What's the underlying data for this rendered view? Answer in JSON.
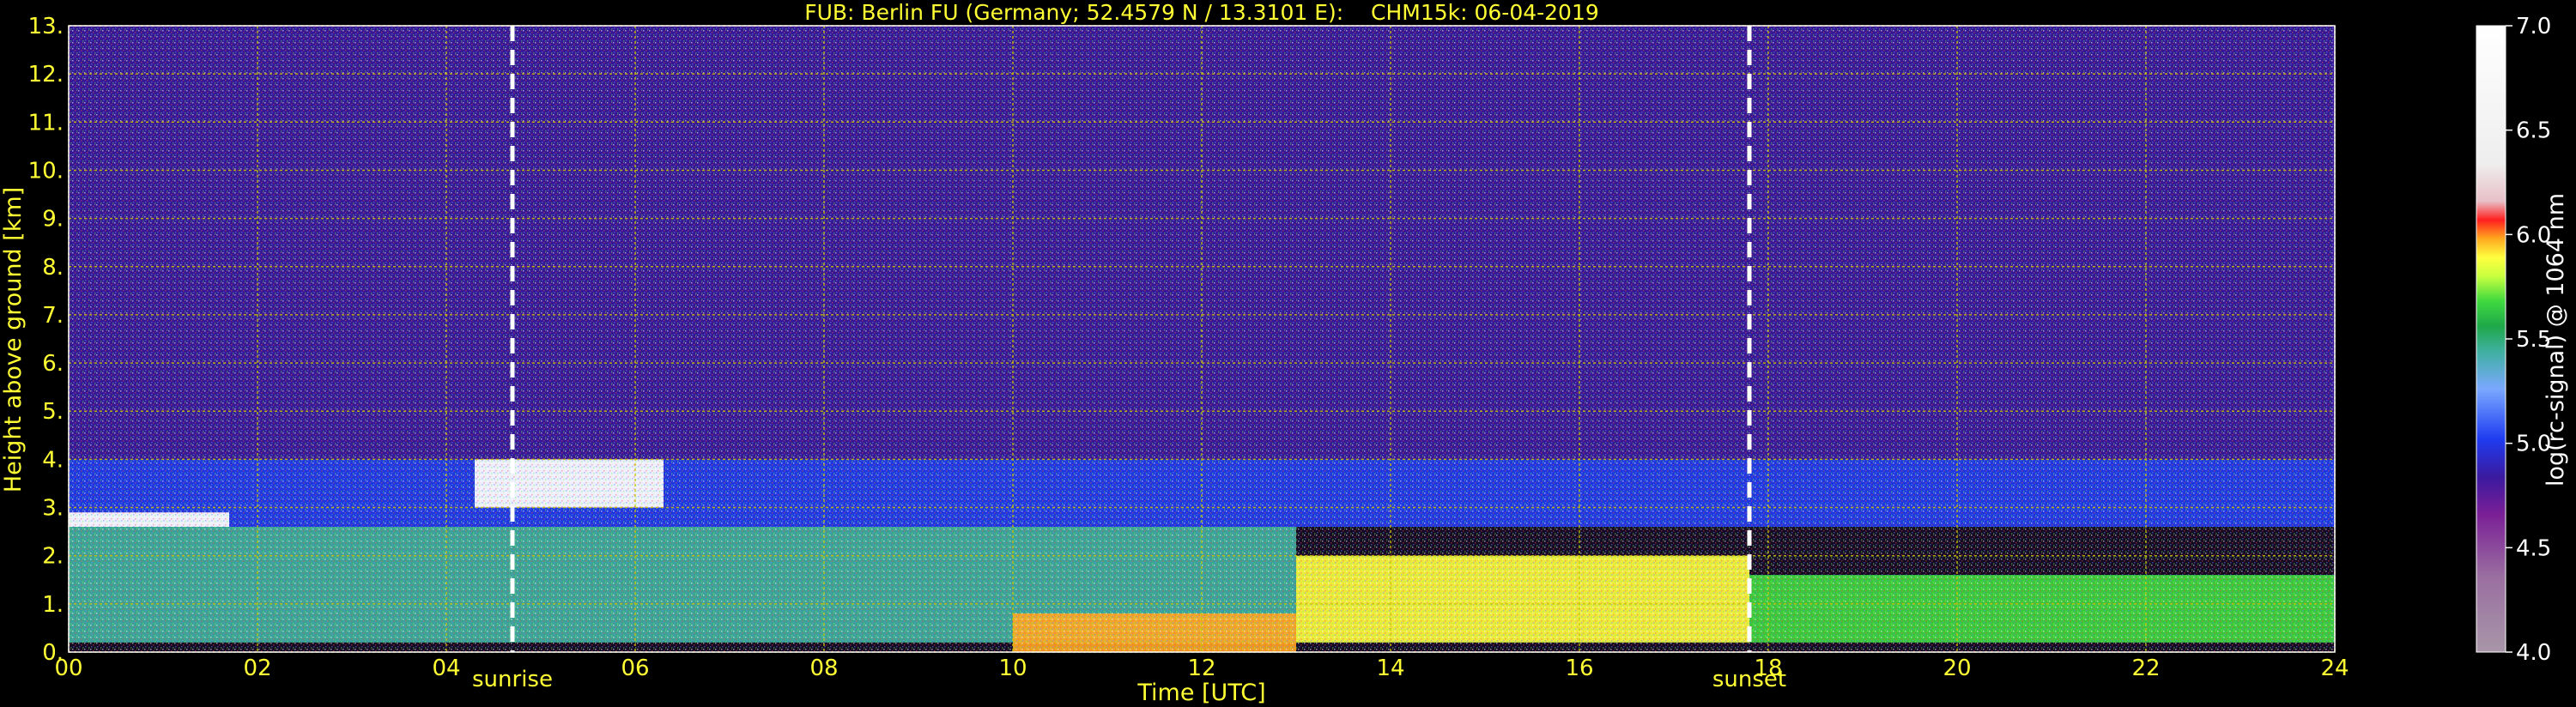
{
  "page": {
    "title": "FUB: Berlin FU (Germany; 52.4579 N / 13.3101 E):    CHM15k: 06-04-2019"
  },
  "colors": {
    "axis_text": "#ffff33",
    "grid": "#c8c800",
    "background": "#000000",
    "marker_line": "#ffffff"
  },
  "chart_data": {
    "type": "heatmap",
    "title": "FUB: Berlin FU (Germany; 52.4579 N / 13.3101 E):    CHM15k: 06-04-2019",
    "xlabel": "Time [UTC]",
    "ylabel": "Height above ground [km]",
    "xlim": [
      0,
      24
    ],
    "ylim": [
      0,
      13
    ],
    "x_ticks": [
      "00",
      "02",
      "04",
      "06",
      "08",
      "10",
      "12",
      "14",
      "16",
      "18",
      "20",
      "22",
      "24"
    ],
    "y_ticks": [
      "0.",
      "1.",
      "2.",
      "3.",
      "4.",
      "5.",
      "6.",
      "7.",
      "8.",
      "9.",
      "10.",
      "11.",
      "12.",
      "13."
    ],
    "grid": true,
    "markers": [
      {
        "label": "sunrise",
        "x": 4.7
      },
      {
        "label": "sunset",
        "x": 17.8
      }
    ],
    "colorbar": {
      "label": "log(rc-signal) @ 1064 nm",
      "range": [
        4.0,
        7.0
      ],
      "ticks": [
        "4.0",
        "4.5",
        "5.0",
        "5.5",
        "6.0",
        "6.5",
        "7.0"
      ]
    },
    "layers": [
      {
        "x0": 0.0,
        "x1": 24.0,
        "y0": 4.0,
        "y1": 13.0,
        "value": 4.9
      },
      {
        "x0": 0.0,
        "x1": 24.0,
        "y0": 2.6,
        "y1": 4.0,
        "value": 5.1
      },
      {
        "x0": 0.0,
        "x1": 13.0,
        "y0": 0.2,
        "y1": 2.6,
        "value": 5.55
      },
      {
        "x0": 13.0,
        "x1": 17.8,
        "y0": 0.2,
        "y1": 2.0,
        "value": 5.9
      },
      {
        "x0": 17.8,
        "x1": 24.0,
        "y0": 0.2,
        "y1": 1.6,
        "value": 5.75
      },
      {
        "x0": 10.0,
        "x1": 13.0,
        "y0": 0.0,
        "y1": 0.8,
        "value": 6.0
      },
      {
        "x0": 0.0,
        "x1": 1.7,
        "y0": 2.6,
        "y1": 2.9,
        "value": 7.0
      },
      {
        "x0": 4.3,
        "x1": 6.3,
        "y0": 3.0,
        "y1": 4.0,
        "value": 7.0
      }
    ]
  }
}
